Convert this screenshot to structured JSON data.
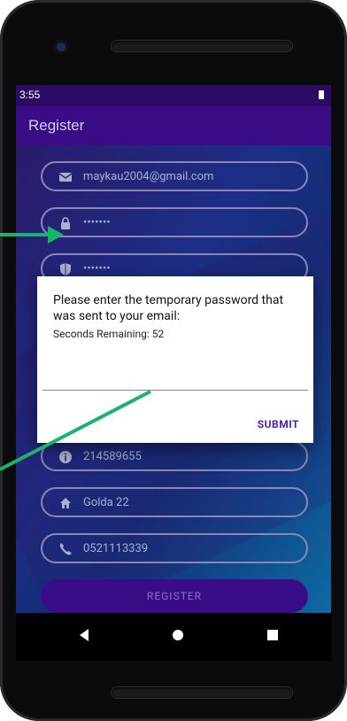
{
  "statusbar": {
    "time": "3:55"
  },
  "appbar": {
    "title": "Register"
  },
  "fields": {
    "email": "maykau2004@gmail.com",
    "password": "•••••••",
    "confirm_password": "•••••••",
    "id": "214589655",
    "address": "Golda 22",
    "phone": "0521113339"
  },
  "dialog": {
    "message": "Please enter the temporary password that was sent to your email:",
    "seconds": "Seconds Remaining: 52",
    "submit": "SUBMIT"
  },
  "register_button": "REGISTER",
  "colors": {
    "accent": "#3a0d86",
    "dialog_action": "#4a1db5",
    "annotation_arrow": "#19b46a"
  }
}
